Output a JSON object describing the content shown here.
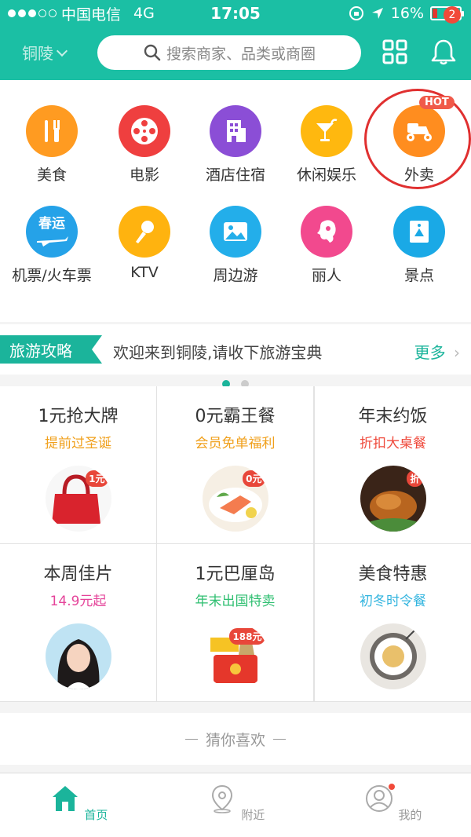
{
  "status_bar": {
    "carrier": "中国电信",
    "network": "4G",
    "time": "17:05",
    "battery": "16%",
    "battery_level": 0.16
  },
  "header": {
    "city": "铜陵",
    "search_placeholder": "搜索商家、品类或商圈",
    "notification_count": "2"
  },
  "categories": [
    {
      "label": "美食",
      "color": "#ff9b21",
      "icon": "fork-knife-icon"
    },
    {
      "label": "电影",
      "color": "#ef3f3f",
      "icon": "film-reel-icon"
    },
    {
      "label": "酒店住宿",
      "color": "#8b4ed6",
      "icon": "building-icon"
    },
    {
      "label": "休闲娱乐",
      "color": "#ffb80f",
      "icon": "cocktail-icon"
    },
    {
      "label": "外卖",
      "color": "#ff8d1f",
      "icon": "delivery-scooter-icon",
      "badge": "HOT"
    },
    {
      "label": "机票/火车票",
      "color": "#25a2e8",
      "icon": "plane-ticket-icon",
      "icon_text": "春运"
    },
    {
      "label": "KTV",
      "color": "#ffb30f",
      "icon": "microphone-icon"
    },
    {
      "label": "周边游",
      "color": "#23aeea",
      "icon": "mountain-photo-icon"
    },
    {
      "label": "丽人",
      "color": "#f2498e",
      "icon": "woman-head-icon"
    },
    {
      "label": "景点",
      "color": "#1aa9e6",
      "icon": "ticket-icon"
    }
  ],
  "pager": {
    "pages": 2,
    "active": 0
  },
  "travel": {
    "tag": "旅游攻略",
    "text": "欢迎来到铜陵,请收下旅游宝典",
    "more": "更多"
  },
  "promos": [
    {
      "title": "1元抢大牌",
      "subtitle": "提前过圣诞",
      "subtitle_color": "#f0a01c",
      "icon": "red-handbag-icon",
      "badge": "1元"
    },
    {
      "title": "0元霸王餐",
      "subtitle": "会员免单福利",
      "subtitle_color": "#f0a01c",
      "icon": "salmon-plate-icon",
      "badge": "0元"
    },
    {
      "title": "年末约饭",
      "subtitle": "折扣大桌餐",
      "subtitle_color": "#ef4a3c",
      "icon": "roast-chicken-icon",
      "badge": "折"
    },
    {
      "title": "本周佳片",
      "subtitle": "14.9元起",
      "subtitle_color": "#e5449a",
      "icon": "actress-portrait-icon"
    },
    {
      "title": "1元巴厘岛",
      "subtitle": "年末出国特卖",
      "subtitle_color": "#2fbf71",
      "icon": "red-envelope-icon",
      "badge": "188元"
    },
    {
      "title": "美食特惠",
      "subtitle": "初冬时令餐",
      "subtitle_color": "#34b5df",
      "icon": "pasta-plate-icon"
    }
  ],
  "guess": {
    "label": "猜你喜欢"
  },
  "tabs": [
    {
      "label": "首页",
      "icon": "home-icon",
      "active": true
    },
    {
      "label": "附近",
      "icon": "location-pin-icon",
      "active": false
    },
    {
      "label": "我的",
      "icon": "profile-icon",
      "active": false
    }
  ]
}
